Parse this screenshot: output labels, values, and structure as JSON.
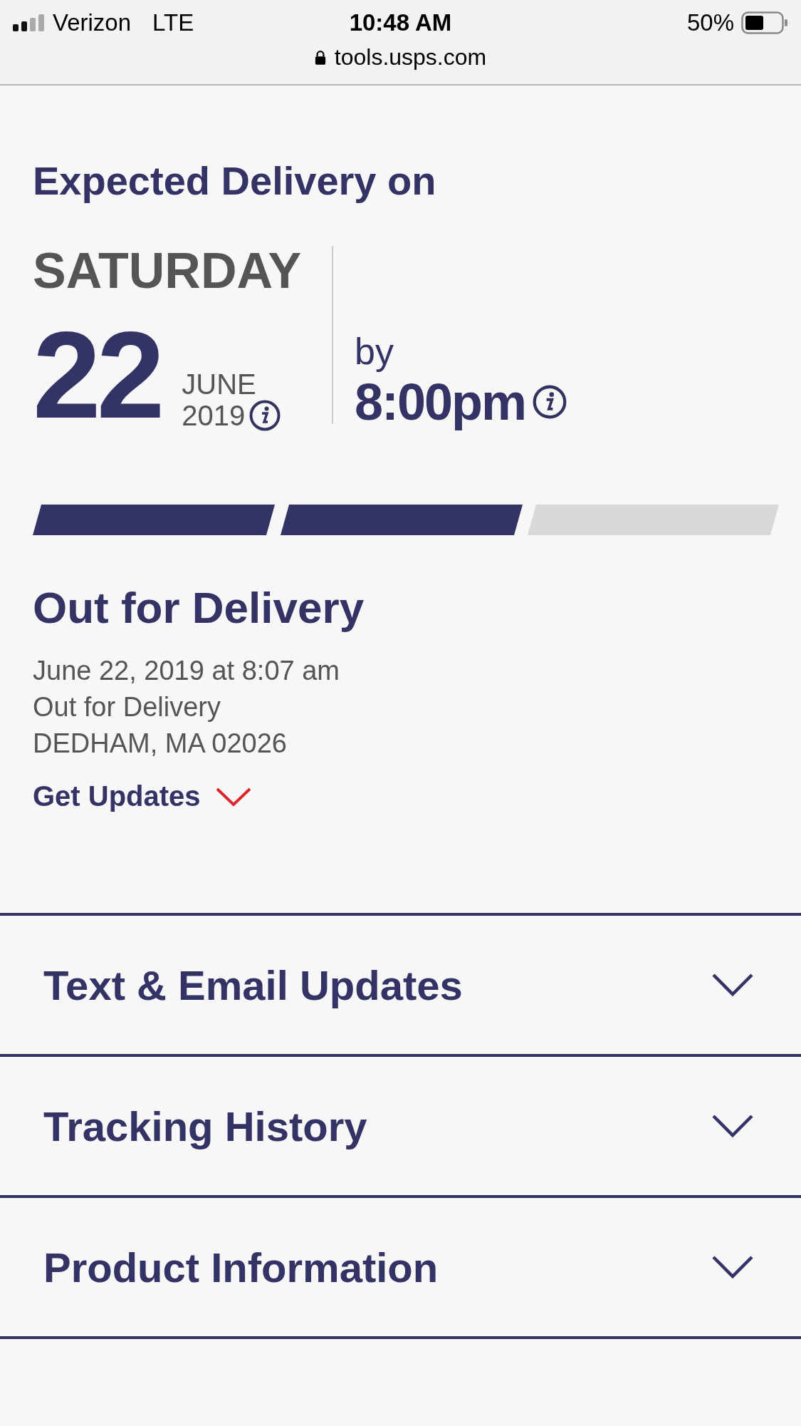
{
  "status_bar": {
    "carrier": "Verizon",
    "network": "LTE",
    "time": "10:48 AM",
    "battery": "50%",
    "url": "tools.usps.com"
  },
  "delivery": {
    "heading": "Expected Delivery on",
    "weekday": "SATURDAY",
    "day": "22",
    "month": "JUNE",
    "year": "2019",
    "by_label": "by",
    "time": "8:00pm"
  },
  "progress": [
    {
      "filled": true
    },
    {
      "filled": true
    },
    {
      "filled": false
    }
  ],
  "status": {
    "title": "Out for Delivery",
    "lines": [
      "June 22, 2019 at 8:07 am",
      "Out for Delivery",
      "DEDHAM, MA 02026"
    ],
    "get_updates": "Get Updates",
    "get_updates_expanded": false
  },
  "sections": [
    {
      "title": "Text & Email Updates",
      "expanded": false
    },
    {
      "title": "Tracking History",
      "expanded": false
    },
    {
      "title": "Product Information",
      "expanded": false
    }
  ]
}
